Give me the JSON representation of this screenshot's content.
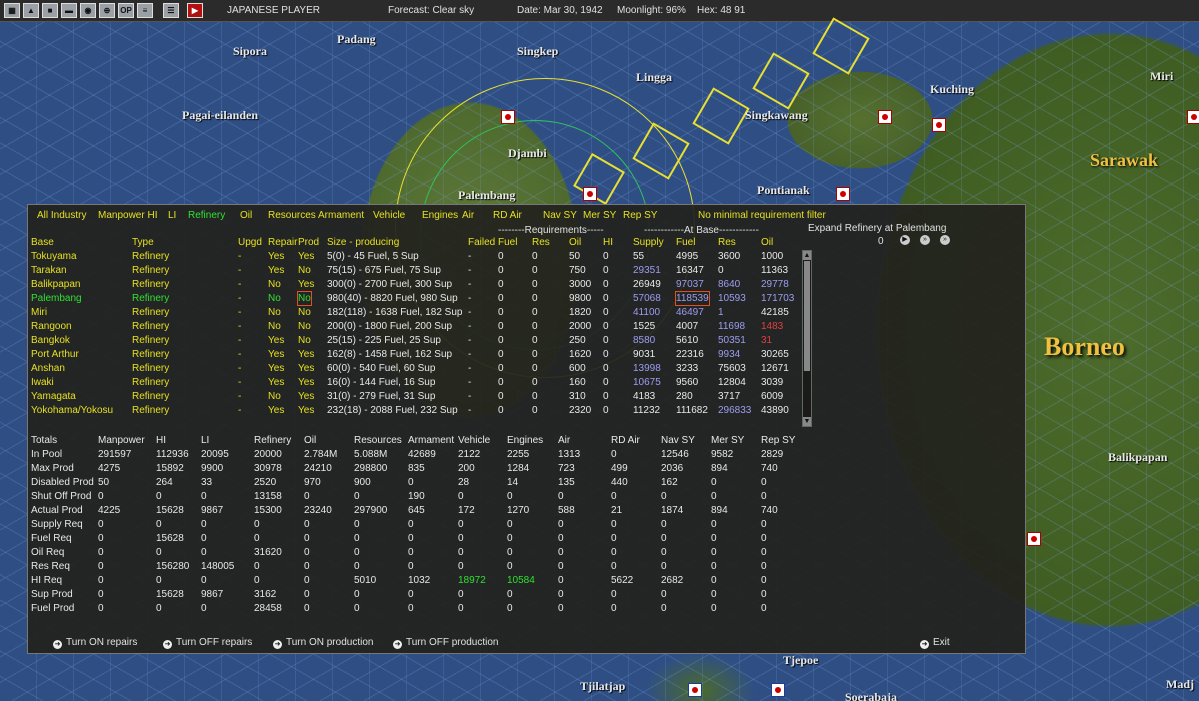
{
  "topbar": {
    "player": "JAPANESE PLAYER",
    "forecast": "Forecast: Clear sky",
    "date": "Date: Mar 30, 1942",
    "moonlight": "Moonlight: 96%",
    "hex": "Hex: 48 91",
    "icons": [
      "map-icon",
      "ship-icon",
      "land-icon",
      "base-icon",
      "globe-icon",
      "target-icon",
      "ops-icon",
      "report-icon",
      "list-icon",
      "end-turn-icon"
    ]
  },
  "map_labels": [
    "Padang",
    "Singkep",
    "Sipora",
    "Lingga",
    "Kuching",
    "Miri",
    "Pagai-eilanden",
    "Singkawang",
    "Djambi",
    "Sarawak",
    "Palembang",
    "Pontianak",
    "Borneo",
    "Balikpapan",
    "Tjepoe",
    "Tjilatjap",
    "Soerabaja",
    "Madj"
  ],
  "filters": [
    "All Industry",
    "Manpower HI",
    "LI",
    "Refinery",
    "Oil",
    "Resources",
    "Armament",
    "Vehicle",
    "Engines",
    "Air",
    "RD Air",
    "Nav SY",
    "Mer SY",
    "Rep SY",
    "No minimal requirement filter"
  ],
  "active_filter": "Refinery",
  "group_headers": {
    "requirements": "--------Requirements-----",
    "at_base": "------------At Base------------"
  },
  "expand": {
    "label": "Expand Refinery at Palembang",
    "value": "0"
  },
  "columns": [
    "Base",
    "Type",
    "Upgd",
    "Repair",
    "Prod",
    "Size - producing",
    "Failed",
    "Fuel",
    "Res",
    "Oil",
    "HI",
    "Supply",
    "Fuel",
    "Res",
    "Oil"
  ],
  "rows": [
    {
      "base": "Tokuyama",
      "type": "Refinery",
      "upgd": "-",
      "repair": "Yes",
      "prod": "Yes",
      "size": "5(0) - 45 Fuel, 5 Sup",
      "failed": "-",
      "req_fuel": "0",
      "req_res": "0",
      "req_oil": "50",
      "req_hi": "0",
      "supply": "55",
      "fuel": "4995",
      "res": "3600",
      "oil": "1000"
    },
    {
      "base": "Tarakan",
      "type": "Refinery",
      "upgd": "-",
      "repair": "Yes",
      "prod": "No",
      "size": "75(15) - 675 Fuel, 75 Sup",
      "failed": "-",
      "req_fuel": "0",
      "req_res": "0",
      "req_oil": "750",
      "req_hi": "0",
      "supply": "29351",
      "fuel": "16347",
      "res": "0",
      "oil": "11363"
    },
    {
      "base": "Balikpapan",
      "type": "Refinery",
      "upgd": "-",
      "repair": "No",
      "prod": "Yes",
      "size": "300(0) - 2700 Fuel, 300 Sup",
      "failed": "-",
      "req_fuel": "0",
      "req_res": "0",
      "req_oil": "3000",
      "req_hi": "0",
      "supply": "26949",
      "fuel": "97037",
      "res": "8640",
      "oil": "29778"
    },
    {
      "base": "Palembang",
      "type": "Refinery",
      "upgd": "-",
      "repair": "No",
      "prod": "No",
      "size": "980(40) - 8820 Fuel, 980 Sup",
      "failed": "-",
      "req_fuel": "0",
      "req_res": "0",
      "req_oil": "9800",
      "req_hi": "0",
      "supply": "57068",
      "fuel": "118539",
      "res": "10593",
      "oil": "171703"
    },
    {
      "base": "Miri",
      "type": "Refinery",
      "upgd": "-",
      "repair": "No",
      "prod": "No",
      "size": "182(118) - 1638 Fuel, 182 Sup",
      "failed": "-",
      "req_fuel": "0",
      "req_res": "0",
      "req_oil": "1820",
      "req_hi": "0",
      "supply": "41100",
      "fuel": "46497",
      "res": "1",
      "oil": "42185"
    },
    {
      "base": "Rangoon",
      "type": "Refinery",
      "upgd": "-",
      "repair": "No",
      "prod": "No",
      "size": "200(0) - 1800 Fuel, 200 Sup",
      "failed": "-",
      "req_fuel": "0",
      "req_res": "0",
      "req_oil": "2000",
      "req_hi": "0",
      "supply": "1525",
      "fuel": "4007",
      "res": "11698",
      "oil": "1483"
    },
    {
      "base": "Bangkok",
      "type": "Refinery",
      "upgd": "-",
      "repair": "Yes",
      "prod": "No",
      "size": "25(15) - 225 Fuel, 25 Sup",
      "failed": "-",
      "req_fuel": "0",
      "req_res": "0",
      "req_oil": "250",
      "req_hi": "0",
      "supply": "8580",
      "fuel": "5610",
      "res": "50351",
      "oil": "31"
    },
    {
      "base": "Port Arthur",
      "type": "Refinery",
      "upgd": "-",
      "repair": "Yes",
      "prod": "Yes",
      "size": "162(8) - 1458 Fuel, 162 Sup",
      "failed": "-",
      "req_fuel": "0",
      "req_res": "0",
      "req_oil": "1620",
      "req_hi": "0",
      "supply": "9031",
      "fuel": "22316",
      "res": "9934",
      "oil": "30265"
    },
    {
      "base": "Anshan",
      "type": "Refinery",
      "upgd": "-",
      "repair": "Yes",
      "prod": "Yes",
      "size": "60(0) - 540 Fuel, 60 Sup",
      "failed": "-",
      "req_fuel": "0",
      "req_res": "0",
      "req_oil": "600",
      "req_hi": "0",
      "supply": "13998",
      "fuel": "3233",
      "res": "75603",
      "oil": "12671"
    },
    {
      "base": "Iwaki",
      "type": "Refinery",
      "upgd": "-",
      "repair": "Yes",
      "prod": "Yes",
      "size": "16(0) - 144 Fuel, 16 Sup",
      "failed": "-",
      "req_fuel": "0",
      "req_res": "0",
      "req_oil": "160",
      "req_hi": "0",
      "supply": "10675",
      "fuel": "9560",
      "res": "12804",
      "oil": "3039"
    },
    {
      "base": "Yamagata",
      "type": "Refinery",
      "upgd": "-",
      "repair": "No",
      "prod": "Yes",
      "size": "31(0) - 279 Fuel, 31 Sup",
      "failed": "-",
      "req_fuel": "0",
      "req_res": "0",
      "req_oil": "310",
      "req_hi": "0",
      "supply": "4183",
      "fuel": "280",
      "res": "3717",
      "oil": "6009"
    },
    {
      "base": "Yokohama/Yokosu",
      "type": "Refinery",
      "upgd": "-",
      "repair": "Yes",
      "prod": "Yes",
      "size": "232(18) - 2088 Fuel, 232 Sup",
      "failed": "-",
      "req_fuel": "0",
      "req_res": "0",
      "req_oil": "2320",
      "req_hi": "0",
      "supply": "11232",
      "fuel": "111682",
      "res": "296833",
      "oil": "43890"
    }
  ],
  "row_colors": {
    "supply": [
      "w",
      "lav",
      "w",
      "lav",
      "lav",
      "w",
      "lav",
      "w",
      "lav",
      "lav",
      "w",
      "w"
    ],
    "fuel": [
      "w",
      "w",
      "lav",
      "lav",
      "lav",
      "w",
      "w",
      "w",
      "w",
      "w",
      "w",
      "w"
    ],
    "res": [
      "w",
      "w",
      "lav",
      "lav",
      "lav",
      "lav",
      "lav",
      "lav",
      "w",
      "w",
      "w",
      "lav"
    ],
    "oil": [
      "w",
      "w",
      "lav",
      "lav",
      "w",
      "red",
      "red",
      "w",
      "w",
      "w",
      "w",
      "w"
    ]
  },
  "totals": {
    "headers": [
      "Totals",
      "Manpower",
      "HI",
      "LI",
      "Refinery",
      "Oil",
      "Resources",
      "Armament",
      "Vehicle",
      "Engines",
      "Air",
      "RD Air",
      "Nav SY",
      "Mer SY",
      "Rep SY"
    ],
    "rows": [
      {
        "label": "In Pool",
        "values": [
          "291597",
          "112936",
          "20095",
          "20000",
          "2.784M",
          "5.088M",
          "42689",
          "2122",
          "2255",
          "1313",
          "0",
          "12546",
          "9582",
          "2829"
        ]
      },
      {
        "label": "Max Prod",
        "values": [
          "4275",
          "15892",
          "9900",
          "30978",
          "24210",
          "298800",
          "835",
          "200",
          "1284",
          "723",
          "499",
          "2036",
          "894",
          "740"
        ]
      },
      {
        "label": "Disabled Prod",
        "values": [
          "50",
          "264",
          "33",
          "2520",
          "970",
          "900",
          "0",
          "28",
          "14",
          "135",
          "440",
          "162",
          "0",
          "0"
        ]
      },
      {
        "label": "Shut Off Prod",
        "values": [
          "0",
          "0",
          "0",
          "13158",
          "0",
          "0",
          "190",
          "0",
          "0",
          "0",
          "0",
          "0",
          "0",
          "0"
        ]
      },
      {
        "label": "Actual Prod",
        "values": [
          "4225",
          "15628",
          "9867",
          "15300",
          "23240",
          "297900",
          "645",
          "172",
          "1270",
          "588",
          "21",
          "1874",
          "894",
          "740"
        ]
      },
      {
        "label": "Supply Req",
        "values": [
          "0",
          "0",
          "0",
          "0",
          "0",
          "0",
          "0",
          "0",
          "0",
          "0",
          "0",
          "0",
          "0",
          "0"
        ]
      },
      {
        "label": "Fuel Req",
        "values": [
          "0",
          "15628",
          "0",
          "0",
          "0",
          "0",
          "0",
          "0",
          "0",
          "0",
          "0",
          "0",
          "0",
          "0"
        ]
      },
      {
        "label": "Oil Req",
        "values": [
          "0",
          "0",
          "0",
          "31620",
          "0",
          "0",
          "0",
          "0",
          "0",
          "0",
          "0",
          "0",
          "0",
          "0"
        ]
      },
      {
        "label": "Res Req",
        "values": [
          "0",
          "156280",
          "148005",
          "0",
          "0",
          "0",
          "0",
          "0",
          "0",
          "0",
          "0",
          "0",
          "0",
          "0"
        ]
      },
      {
        "label": "HI Req",
        "values": [
          "0",
          "0",
          "0",
          "0",
          "0",
          "5010",
          "1032",
          "18972",
          "10584",
          "0",
          "5622",
          "2682",
          "0",
          "0"
        ]
      },
      {
        "label": "Sup Prod",
        "values": [
          "0",
          "15628",
          "9867",
          "3162",
          "0",
          "0",
          "0",
          "0",
          "0",
          "0",
          "0",
          "0",
          "0",
          "0"
        ]
      },
      {
        "label": "Fuel Prod",
        "values": [
          "0",
          "0",
          "0",
          "28458",
          "0",
          "0",
          "0",
          "0",
          "0",
          "0",
          "0",
          "0",
          "0",
          "0"
        ]
      }
    ]
  },
  "actions": {
    "on_repairs": "Turn ON repairs",
    "off_repairs": "Turn OFF repairs",
    "on_production": "Turn ON production",
    "off_production": "Turn OFF production",
    "exit": "Exit"
  },
  "colors": {
    "yellow_text": "#e6e020",
    "green_text": "#30e030",
    "lavender_text": "#9d9df0",
    "red_text": "#e04040",
    "highlight_box": "#e05020"
  }
}
